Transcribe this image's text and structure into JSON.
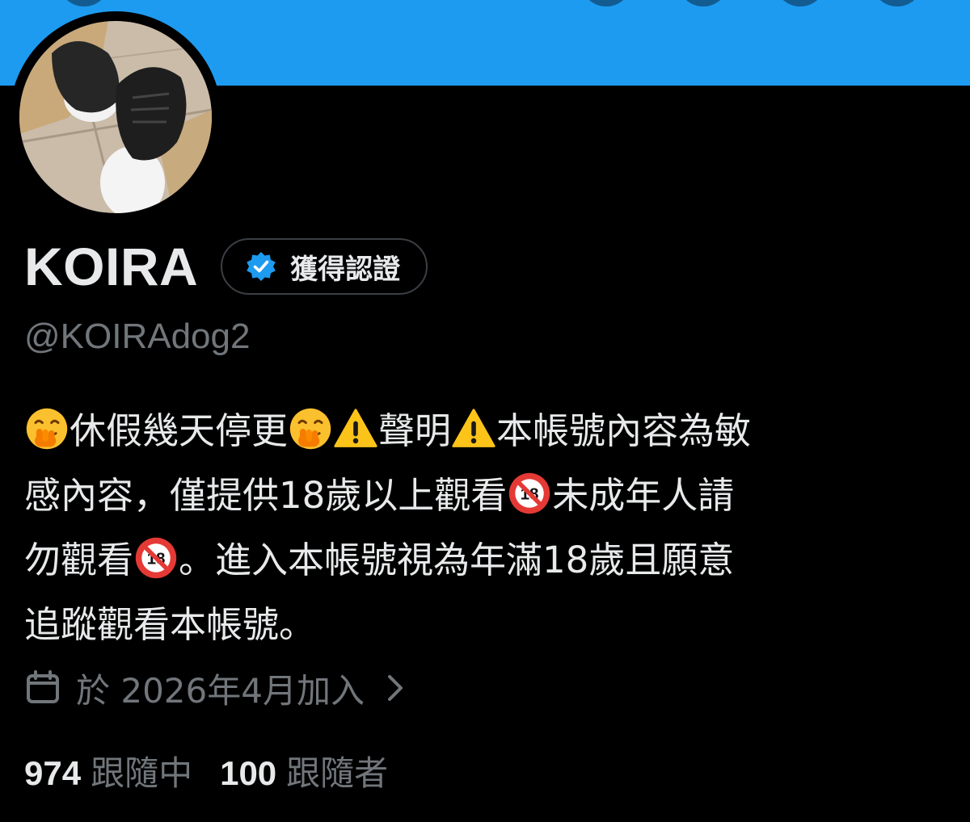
{
  "profile": {
    "display_name": "KOIRA",
    "verified_label": "獲得認證",
    "handle": "@KOIRAdog2",
    "avatar_icon": "avatar-photo-shoes",
    "banner_color": "#1d9bf0",
    "verified_color": "#1d9bf0"
  },
  "bio": {
    "line1": {
      "part1": "休假幾天停更",
      "part2": "聲明",
      "part3": "本帳號內容為敏"
    },
    "line2": {
      "part1": "感內容，僅提供18歲以上觀看",
      "part2": "未成年人請"
    },
    "line3": {
      "part1": "勿觀看",
      "part2": "。進入本帳號視為年滿18歲且願意"
    },
    "line4": "追蹤觀看本帳號。",
    "emoji": {
      "hand_over_mouth": "face-with-hand-over-mouth-icon",
      "warning": "warning-icon",
      "no_under_18": "no-one-under-eighteen-icon"
    }
  },
  "joined": {
    "text": "於 2026年4月加入",
    "icon": "calendar-icon"
  },
  "stats": {
    "following_count": "974",
    "following_label": "跟隨中",
    "followers_count": "100",
    "followers_label": "跟隨者"
  }
}
